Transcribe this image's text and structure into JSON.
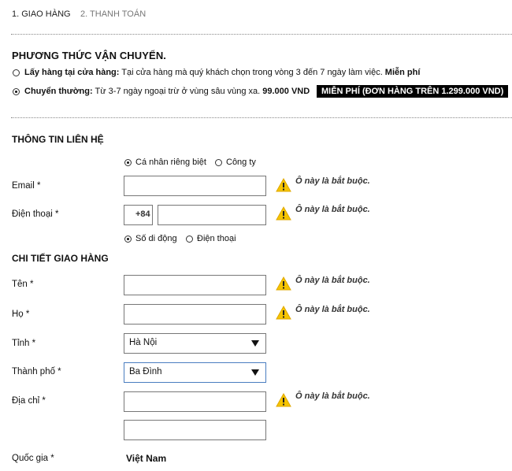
{
  "steps": {
    "step1": "1. GIAO HÀNG",
    "step2": "2. THANH TOÁN"
  },
  "shipping": {
    "title": "PHƯƠNG THỨC VẬN CHUYỂN.",
    "pickup": {
      "name": "Lấy hàng tại cửa hàng:",
      "desc": " Tại cửa hàng mà quý khách chọn trong vòng 3 đến 7 ngày làm việc.",
      "price": " Miễn phí",
      "selected": false
    },
    "standard": {
      "name": "Chuyển thường:",
      "desc": " Từ 3-7 ngày ngoại trừ ở vùng sâu vùng xa.",
      "price": " 99.000 VND",
      "badge": "MIỄN PHÍ (ĐƠN HÀNG TRÊN 1.299.000 VND)",
      "selected": true
    }
  },
  "contact": {
    "title": "THÔNG TIN LIÊN HỆ",
    "type_individual": "Cá nhân riêng biệt",
    "type_company": "Công ty",
    "email_label": "Email *",
    "email_value": "",
    "phone_label": "Điện thoại *",
    "phone_prefix": "+84",
    "phone_value": "",
    "mobile": "Số di động",
    "landline": "Điện thoại",
    "required_msg": "Ô này là bắt buộc."
  },
  "delivery": {
    "title": "CHI TIẾT GIAO HÀNG",
    "first_name_label": "Tên *",
    "last_name_label": "Họ *",
    "province_label": "Tỉnh *",
    "province_value": "Hà Nội",
    "city_label": "Thành phố *",
    "city_value": "Ba Đình",
    "address_label": "Địa chỉ *",
    "country_label": "Quốc gia *",
    "country_value": "Việt Nam",
    "required_msg": "Ô này là bắt buộc."
  }
}
